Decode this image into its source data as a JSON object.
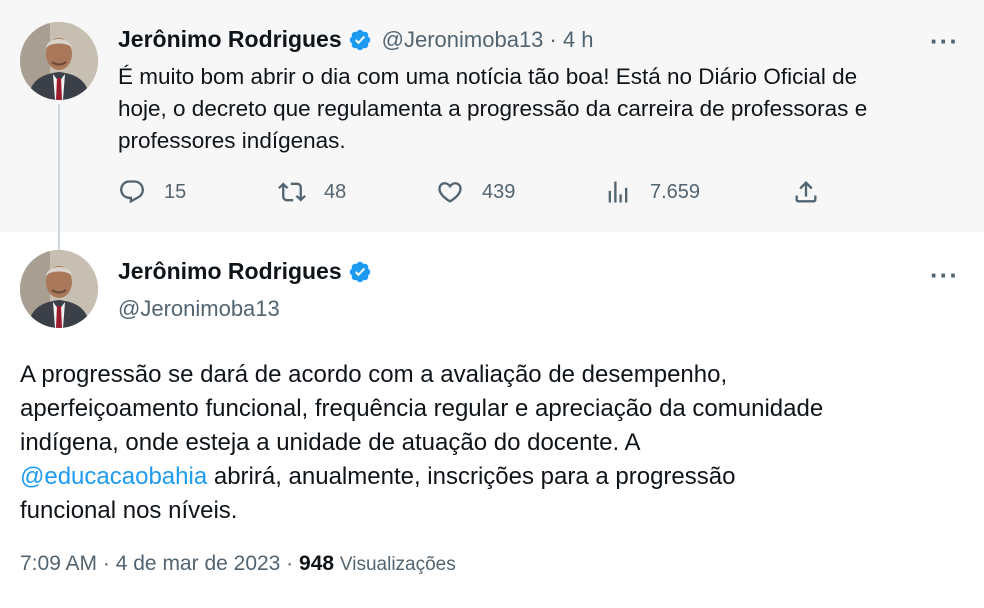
{
  "tweet1": {
    "author_name": "Jerônimo Rodrigues",
    "handle": "@Jeronimoba13",
    "time": "· 4 h",
    "more_label": "···",
    "lines": [
      "É muito bom abrir o dia com uma notícia tão boa! Está no Diário Oficial de",
      "hoje, o decreto que regulamenta a progressão da carreira de professoras e",
      "professores indígenas."
    ],
    "stats": {
      "replies": "15",
      "retweets": "48",
      "likes": "439",
      "views": "7.659"
    }
  },
  "tweet2": {
    "author_name": "Jerônimo Rodrigues",
    "handle": "@Jeronimoba13",
    "more_label": "···",
    "line1": "A progressão se dará de acordo com a avaliação de desempenho,",
    "line2": "aperfeiçoamento funcional, frequência regular e apreciação da comunidade",
    "line3": "indígena, onde esteja a unidade de atuação do docente. A",
    "mention": "@educacaobahia",
    "line4_rest": " abrirá, anualmente, inscrições para a progressão",
    "line5": "funcional nos níveis.",
    "time": "7:09 AM",
    "date": "· 4 de mar de 2023 ·",
    "views_count": "948",
    "views_label": "Visualizações"
  },
  "colors": {
    "accent": "#1d9bf0",
    "muted": "#536471",
    "text": "#0f1419",
    "thread_bg": "#f7f7f7"
  },
  "icons": [
    "verified-badge-icon",
    "reply-icon",
    "retweet-icon",
    "like-icon",
    "views-icon",
    "share-icon",
    "more-icon"
  ]
}
